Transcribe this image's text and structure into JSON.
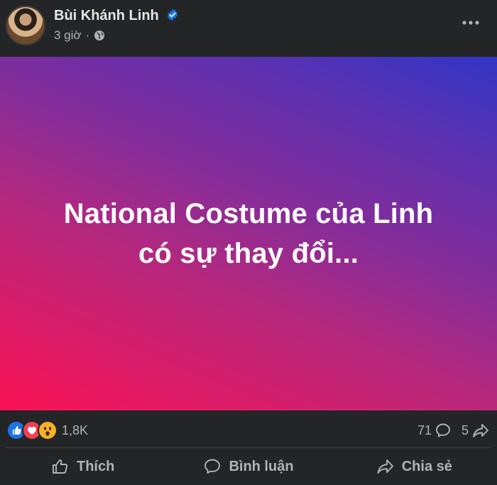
{
  "post": {
    "author": "Bùi Khánh Linh",
    "time": "3 giờ",
    "separator": "·",
    "text_line1": "National Costume của Linh",
    "text_line2": "có sự thay đổi...",
    "background_gradient": [
      "#fb1255",
      "#b6287d",
      "#8a2c97",
      "#5e31b0",
      "#3035c6"
    ]
  },
  "stats": {
    "reaction_count": "1,8K",
    "comment_count": "71",
    "share_count": "5",
    "reactions": [
      "like",
      "love",
      "wow"
    ]
  },
  "actions": {
    "like": "Thích",
    "comment": "Bình luận",
    "share": "Chia sẻ"
  },
  "colors": {
    "background": "#242526",
    "text_primary": "#e4e6eb",
    "text_secondary": "#b0b3b8",
    "verified": "#1b74e4"
  }
}
